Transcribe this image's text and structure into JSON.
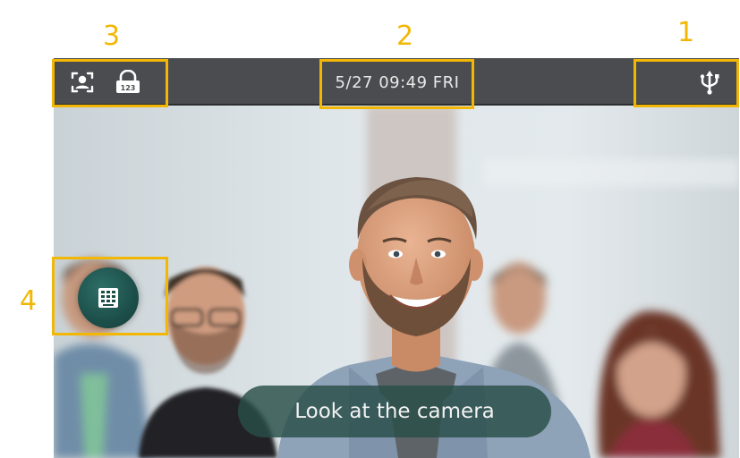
{
  "callouts": {
    "one": "1",
    "two": "2",
    "three": "3",
    "four": "4"
  },
  "status_bar": {
    "datetime": "5/27 09:49  FRI",
    "left_icons": [
      "face-recognition-icon",
      "password-unlock-icon"
    ],
    "password_icon_text": "123",
    "right_icon": "usb-icon"
  },
  "camera": {
    "prompt": "Look at the camera",
    "keypad_icon": "keypad-icon"
  },
  "colors": {
    "highlight": "#f2b705",
    "status_bar": "#4a4c4f",
    "prompt_bg": "#284e48",
    "keypad_button": "#1d4f4a"
  }
}
